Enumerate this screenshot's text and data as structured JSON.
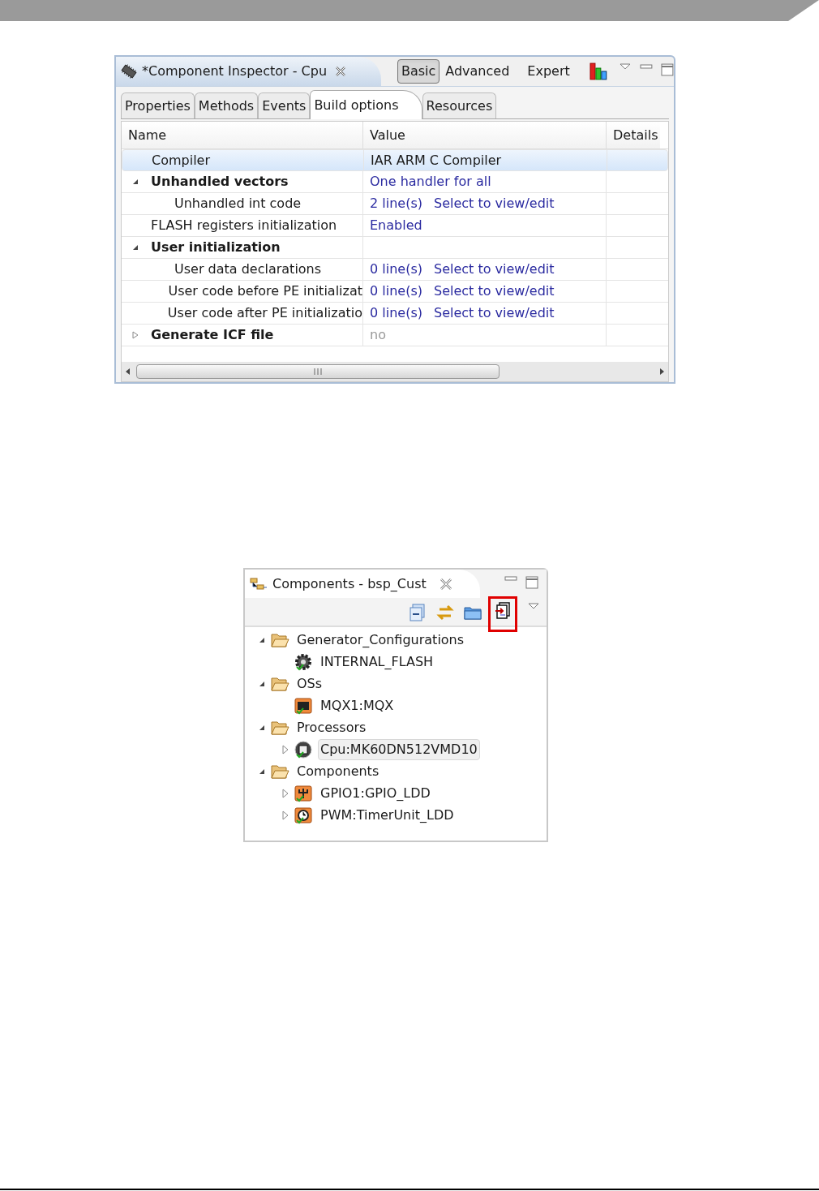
{
  "inspector": {
    "title": "*Component Inspector - Cpu",
    "modes": [
      {
        "label": "Basic",
        "selected": true
      },
      {
        "label": "Advanced",
        "selected": false
      },
      {
        "label": "Expert",
        "selected": false
      }
    ],
    "tabs": [
      {
        "label": "Properties",
        "selected": false
      },
      {
        "label": "Methods",
        "selected": false
      },
      {
        "label": "Events",
        "selected": false
      },
      {
        "label": "Build options",
        "selected": true
      },
      {
        "label": "Resources",
        "selected": false
      }
    ],
    "columns": [
      "Name",
      "Value",
      "Details"
    ],
    "rows": [
      {
        "name": "Compiler",
        "kind": "item",
        "selected": true,
        "value": {
          "text": "IAR ARM C Compiler",
          "kind": "plain"
        }
      },
      {
        "name": "Unhandled vectors",
        "kind": "group",
        "selected": false,
        "expanded": true,
        "value": {
          "text": "One handler for all",
          "kind": "link"
        },
        "children": [
          {
            "name": "Unhandled int code",
            "kind": "item",
            "selected": false,
            "value": {
              "text": "2 line(s)",
              "kind": "link"
            },
            "action": "Select to view/edit"
          }
        ]
      },
      {
        "name": "FLASH registers initialization",
        "kind": "item",
        "selected": false,
        "value": {
          "text": "Enabled",
          "kind": "link"
        }
      },
      {
        "name": "User initialization",
        "kind": "group",
        "selected": false,
        "expanded": true,
        "children": [
          {
            "name": "User data declarations",
            "kind": "item",
            "selected": false,
            "value": {
              "text": "0 line(s)",
              "kind": "link"
            },
            "action": "Select to view/edit"
          },
          {
            "name": "User code before PE initializat",
            "kind": "item",
            "selected": false,
            "value": {
              "text": "0 line(s)",
              "kind": "link"
            },
            "action": "Select to view/edit"
          },
          {
            "name": "User code after PE initializatio",
            "kind": "item",
            "selected": false,
            "value": {
              "text": "0 line(s)",
              "kind": "link"
            },
            "action": "Select to view/edit"
          }
        ]
      },
      {
        "name": "Generate ICF file",
        "kind": "group",
        "selected": false,
        "expanded": false,
        "value": {
          "text": "no",
          "kind": "disabled"
        }
      }
    ]
  },
  "components": {
    "title": "Components - bsp_Cust",
    "toolbar": [
      {
        "kind": "collapse",
        "highlighted": false
      },
      {
        "kind": "link",
        "highlighted": false
      },
      {
        "kind": "folder",
        "highlighted": false
      },
      {
        "kind": "export",
        "highlighted": true
      }
    ],
    "tree": [
      {
        "label": "Generator_Configurations",
        "kind": "folder",
        "expanded": true,
        "children": [
          {
            "label": "INTERNAL_FLASH",
            "kind": "gear",
            "selected": false
          }
        ]
      },
      {
        "label": "OSs",
        "kind": "folder",
        "expanded": true,
        "children": [
          {
            "label": "MQX1:MQX",
            "kind": "os",
            "selected": false
          }
        ]
      },
      {
        "label": "Processors",
        "kind": "folder",
        "expanded": true,
        "children": [
          {
            "label": "Cpu:MK60DN512VMD10",
            "kind": "cpu",
            "expanded": false,
            "selected": true
          }
        ]
      },
      {
        "label": "Components",
        "kind": "folder",
        "expanded": true,
        "children": [
          {
            "label": "GPIO1:GPIO_LDD",
            "kind": "gpio",
            "expanded": false,
            "selected": false
          },
          {
            "label": "PWM:TimerUnit_LDD",
            "kind": "timer",
            "expanded": false,
            "selected": false
          }
        ]
      }
    ]
  }
}
